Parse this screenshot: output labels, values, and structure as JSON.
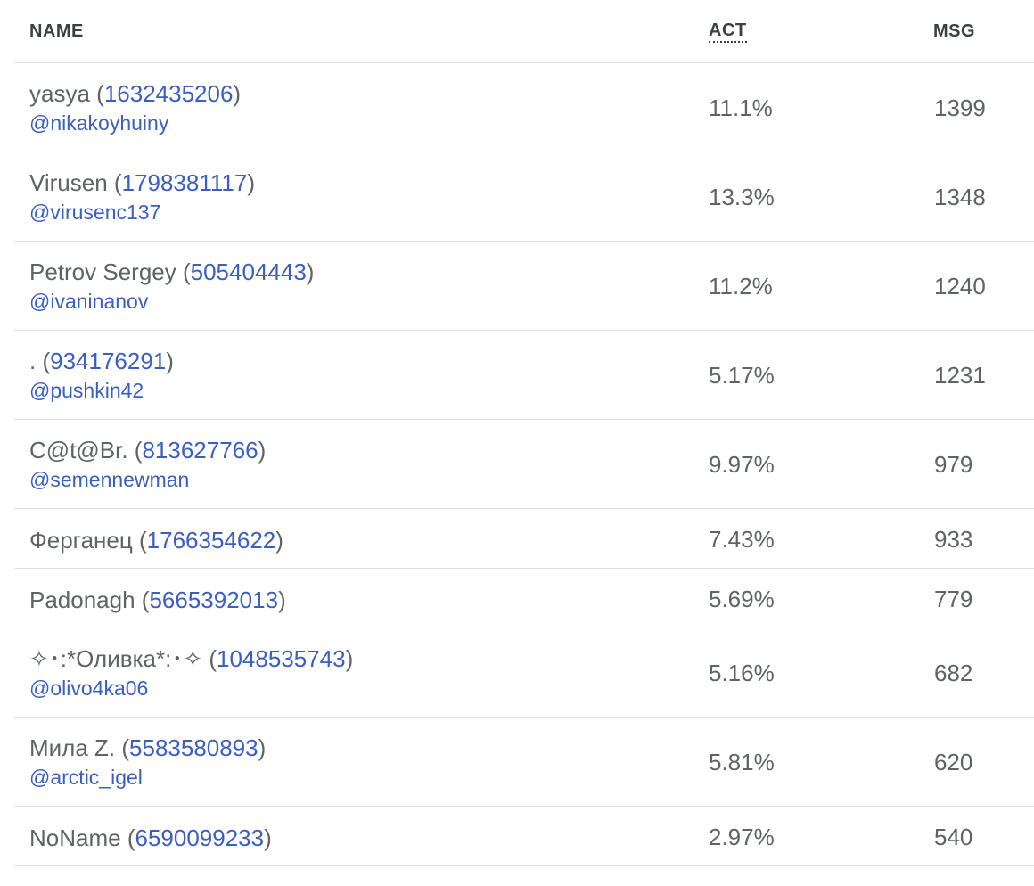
{
  "header": {
    "name": "NAME",
    "act": "ACT",
    "msg": "MSG"
  },
  "rows": [
    {
      "name": "yasya",
      "id": "1632435206",
      "username": "@nikakoyhuiny",
      "act": "11.1%",
      "msg": "1399"
    },
    {
      "name": "Virusen",
      "id": "1798381117",
      "username": "@virusenc137",
      "act": "13.3%",
      "msg": "1348"
    },
    {
      "name": "Petrov Sergey",
      "id": "505404443",
      "username": "@ivaninanov",
      "act": "11.2%",
      "msg": "1240"
    },
    {
      "name": ".",
      "id": "934176291",
      "username": "@pushkin42",
      "act": "5.17%",
      "msg": "1231"
    },
    {
      "name": "C@t@Br.",
      "id": "813627766",
      "username": "@semennewman",
      "act": "9.97%",
      "msg": "979"
    },
    {
      "name": "Ферганец",
      "id": "1766354622",
      "username": "",
      "act": "7.43%",
      "msg": "933"
    },
    {
      "name": "Padonagh",
      "id": "5665392013",
      "username": "",
      "act": "5.69%",
      "msg": "779"
    },
    {
      "name": "✧･:*Оливка*:･✧",
      "id": "1048535743",
      "username": "@olivo4ka06",
      "act": "5.16%",
      "msg": "682"
    },
    {
      "name": "Мила Z.",
      "id": "5583580893",
      "username": "@arctic_igel",
      "act": "5.81%",
      "msg": "620"
    },
    {
      "name": "NoName",
      "id": "6590099233",
      "username": "",
      "act": "2.97%",
      "msg": "540"
    }
  ]
}
